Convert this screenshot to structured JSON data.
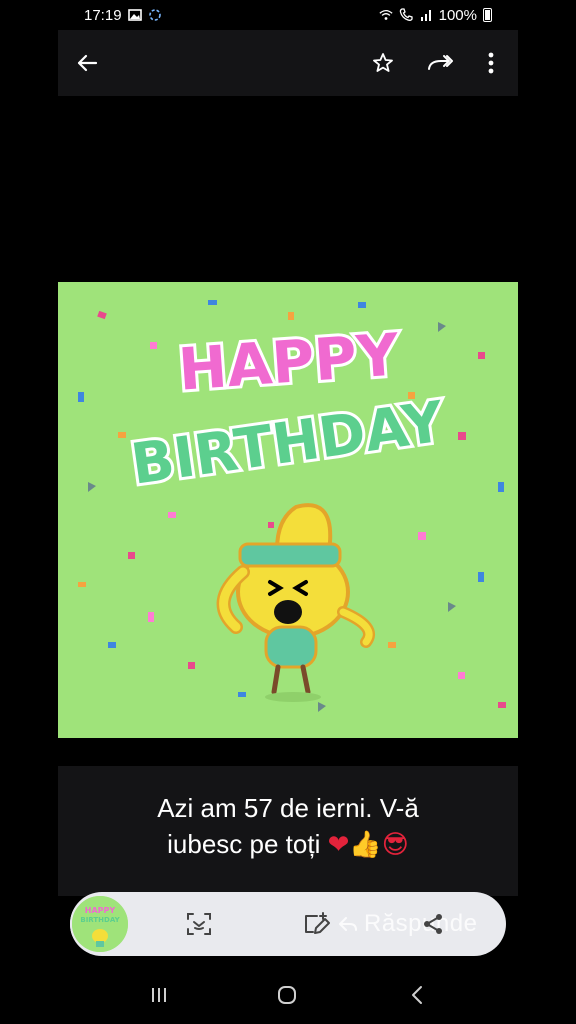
{
  "status_bar": {
    "time": "17:19",
    "battery_text": "100%",
    "icons": [
      "gallery-icon",
      "app-icon",
      "wifi-icon",
      "call-icon",
      "signal-icon",
      "battery-icon"
    ]
  },
  "toolbar": {
    "back_icon": "arrow-left-icon",
    "star_icon": "star-outline-icon",
    "forward_icon": "forward-icon",
    "more_icon": "more-vertical-icon"
  },
  "gif": {
    "line1": "HAPPY",
    "line2": "BIRTHDAY",
    "colors": {
      "background": "#9fe37a",
      "happy": "#f06ad0",
      "birthday": "#5ccf8e",
      "bird": "#f4de3a",
      "headband": "#5fc7a0"
    }
  },
  "caption": {
    "line1": "Azi am 57 de ierni. V-ă",
    "line2": "iubesc pe toți",
    "emojis": "❤👍😎"
  },
  "action_bar": {
    "reply_label": "Răspunde",
    "icons": [
      "thumbnail",
      "scan-icon",
      "edit-icon",
      "reply-icon",
      "share-icon"
    ]
  },
  "nav_bar": {
    "icons": [
      "recent-apps-icon",
      "home-icon",
      "back-icon"
    ]
  }
}
